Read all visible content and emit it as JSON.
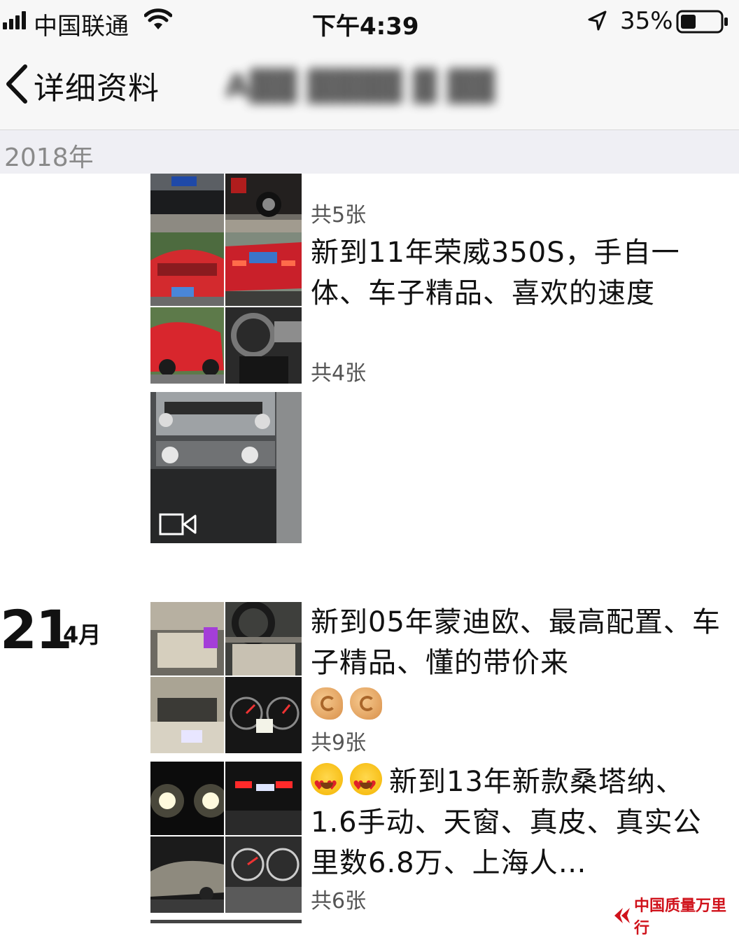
{
  "status_bar": {
    "carrier": "中国联通",
    "time": "下午4:39",
    "battery_percent": "35%",
    "icons": [
      "signal-icon",
      "wifi-icon",
      "location-arrow-icon",
      "battery-icon"
    ]
  },
  "nav": {
    "back_label": "详细资料",
    "title": "A▓▓ ▓▓▓▓ ▓ ▓▓"
  },
  "year_header": "2018年",
  "posts": [
    {
      "text": "",
      "count": "共5张",
      "photos": [
        "car-black-rear-plate",
        "suv-dark-rear"
      ]
    },
    {
      "text": "新到11年荣威350S，手自一体、车子精品、喜欢的速度",
      "count": "共4张",
      "photos": [
        "red-sedan-front",
        "red-sedan-rear",
        "red-sedan-side",
        "red-sedan-interior"
      ]
    },
    {
      "text": "",
      "count": "",
      "video": true,
      "photos": [
        "dashboard-console-video"
      ]
    },
    {
      "date_day": "21",
      "date_month": "4月",
      "text": "新到05年蒙迪欧、最高配置、车子精品、懂的带价来",
      "emoji": [
        "snail-hand-emoji",
        "snail-hand-emoji"
      ],
      "count": "共9张",
      "photos": [
        "beige-seats",
        "steering-wheel",
        "glovebox",
        "instrument-cluster"
      ]
    },
    {
      "emoji": [
        "heart-eyes-emoji",
        "heart-eyes-emoji"
      ],
      "text": "新到13年新款桑塔纳、1.6手动、天窗、真皮、真实公里数6.8万、上海人…",
      "count": "共6张",
      "photos": [
        "headlights-night",
        "taillights-night",
        "silver-sedan-side",
        "speedometer"
      ]
    }
  ],
  "watermark": "中国质量万里行",
  "colors": {
    "bar_bg": "#f7f7f7",
    "year_bg": "#efeff4",
    "watermark_red": "#d0121b"
  }
}
